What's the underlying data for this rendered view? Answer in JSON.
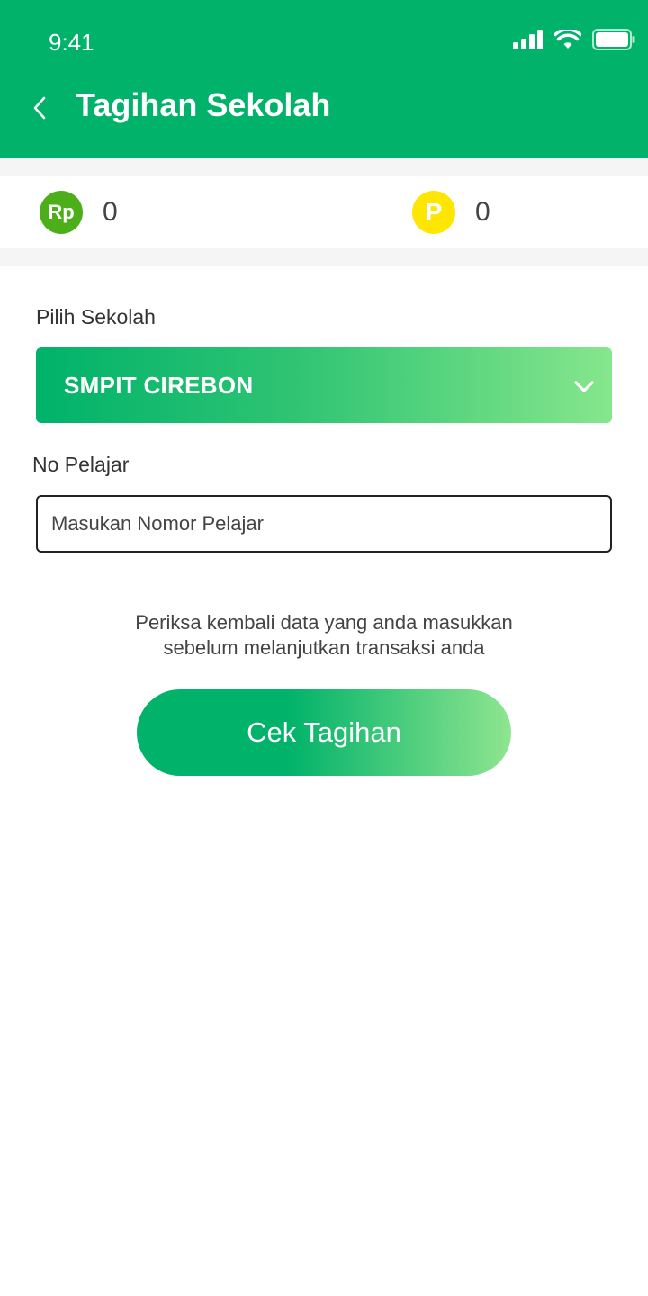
{
  "status_bar": {
    "time": "9:41"
  },
  "header": {
    "title": "Tagihan Sekolah",
    "back_icon": "chevron-left-icon"
  },
  "balances": [
    {
      "icon_text": "Rp",
      "value": "0",
      "icon_color": "#4caf1a"
    },
    {
      "icon_text": "P",
      "value": "0",
      "icon_color": "#ffe600"
    }
  ],
  "form": {
    "school_label": "Pilih Sekolah",
    "school_selected": "SMPIT CIREBON",
    "student_label": "No Pelajar",
    "student_value": "",
    "student_placeholder": "Masukan Nomor Pelajar"
  },
  "notice": {
    "line1": "Periksa kembali data yang anda masukkan",
    "line2": "sebelum melanjutkan transaksi anda"
  },
  "submit_label": "Cek Tagihan",
  "colors": {
    "primary": "#00b26a",
    "gradient_end": "#86e68c",
    "background": "#ffffff",
    "separator": "#f5f5f5"
  }
}
